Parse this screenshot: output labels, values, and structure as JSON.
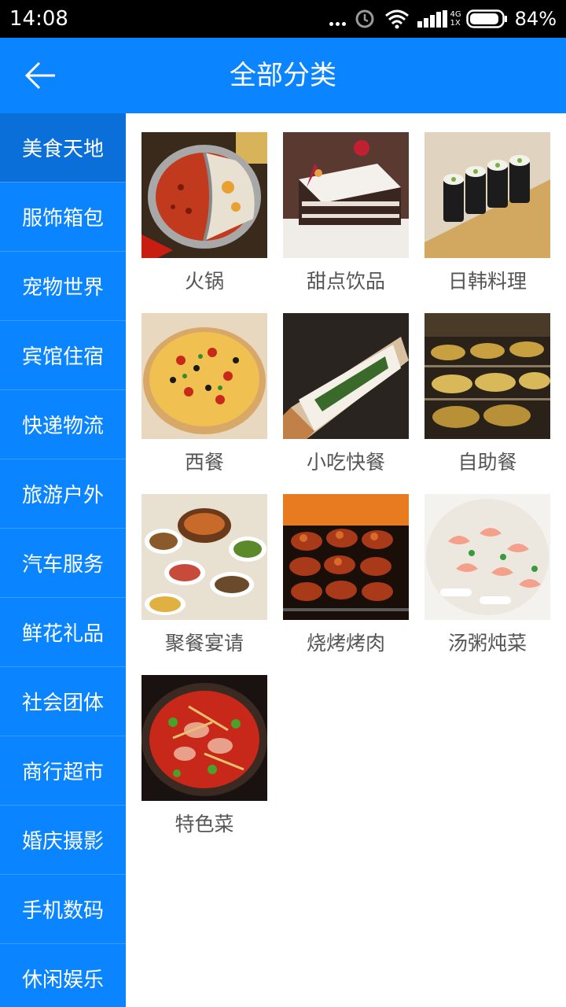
{
  "status_bar": {
    "time": "14:08",
    "network": [
      "4G",
      "1X"
    ],
    "battery": "84%",
    "icons": [
      "more-dots-icon",
      "alarm-icon",
      "wifi-icon",
      "signal-icon",
      "battery-icon"
    ]
  },
  "header": {
    "title": "全部分类",
    "back_icon": "arrow-left-icon",
    "color": "#0a84ff"
  },
  "sidebar": {
    "items": [
      {
        "label": "美食天地",
        "active": true
      },
      {
        "label": "服饰箱包"
      },
      {
        "label": "宠物世界"
      },
      {
        "label": "宾馆住宿"
      },
      {
        "label": "快递物流"
      },
      {
        "label": "旅游户外"
      },
      {
        "label": "汽车服务"
      },
      {
        "label": "鲜花礼品"
      },
      {
        "label": "社会团体"
      },
      {
        "label": "商行超市"
      },
      {
        "label": "婚庆摄影"
      },
      {
        "label": "手机数码"
      },
      {
        "label": "休闲娱乐"
      }
    ]
  },
  "grid": {
    "items": [
      {
        "label": "火锅",
        "image": "hotpot-photo"
      },
      {
        "label": "甜点饮品",
        "image": "cake-photo"
      },
      {
        "label": "日韩料理",
        "image": "sushi-photo"
      },
      {
        "label": "西餐",
        "image": "pizza-photo"
      },
      {
        "label": "小吃快餐",
        "image": "sandwich-photo"
      },
      {
        "label": "自助餐",
        "image": "buffet-photo"
      },
      {
        "label": "聚餐宴请",
        "image": "banquet-photo"
      },
      {
        "label": "烧烤烤肉",
        "image": "bbq-photo"
      },
      {
        "label": "汤粥炖菜",
        "image": "soup-photo"
      },
      {
        "label": "特色菜",
        "image": "specialty-dish-photo"
      }
    ]
  }
}
